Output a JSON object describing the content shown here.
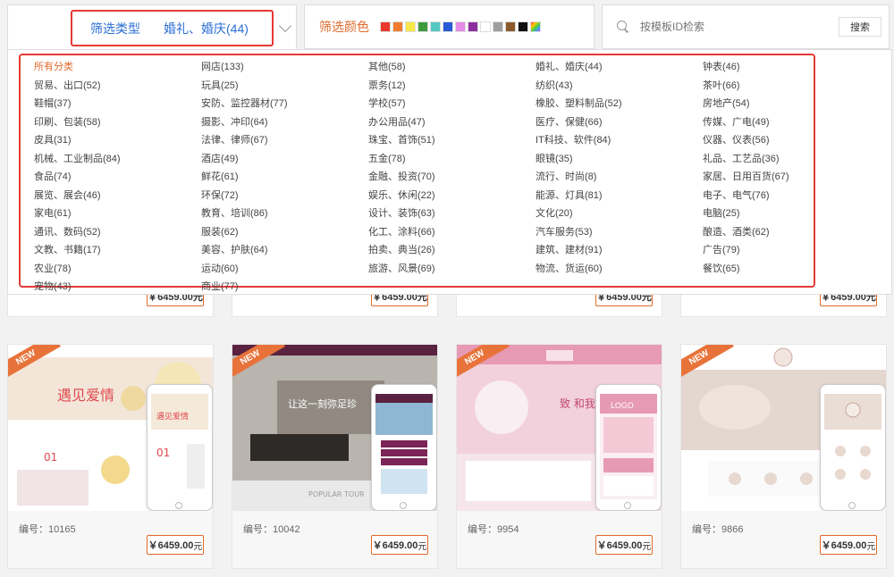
{
  "filters": {
    "type_label": "筛选类型",
    "type_value": "婚礼、婚庆(44)",
    "color_label": "筛选颜色",
    "colors": [
      "#e8392c",
      "#ef7b2f",
      "#f6e84a",
      "#3d9a3d",
      "#55c7c3",
      "#2a5bd7",
      "#e58be6",
      "#8e2fa0",
      "#ffffff",
      "#9e9e9e",
      "#8b5a2b",
      "#111111"
    ],
    "search_placeholder": "按模板ID检索",
    "search_button": "搜索"
  },
  "categories": [
    "所有分类",
    "网店(133)",
    "其他(58)",
    "婚礼、婚庆(44)",
    "钟表(46)",
    "贸易、出口(52)",
    "玩具(25)",
    "票务(12)",
    "纺织(43)",
    "茶叶(66)",
    "鞋帽(37)",
    "安防、监控器材(77)",
    "学校(57)",
    "橡胶、塑料制品(52)",
    "房地产(54)",
    "印刷、包装(58)",
    "摄影、冲印(64)",
    "办公用品(47)",
    "医疗、保健(66)",
    "传媒、广电(49)",
    "皮具(31)",
    "法律、律师(67)",
    "珠宝、首饰(51)",
    "IT科技、软件(84)",
    "仪器、仪表(56)",
    "机械、工业制品(84)",
    "酒店(49)",
    "五金(78)",
    "眼镜(35)",
    "礼品、工艺品(36)",
    "食品(74)",
    "鲜花(61)",
    "金融、投资(70)",
    "流行、时尚(8)",
    "家居、日用百货(67)",
    "展览、展会(46)",
    "环保(72)",
    "娱乐、休闲(22)",
    "能源、灯具(81)",
    "电子、电气(76)",
    "家电(61)",
    "教育、培训(86)",
    "设计、装饰(63)",
    "文化(20)",
    "电脑(25)",
    "通讯、数码(52)",
    "服装(62)",
    "化工、涂料(66)",
    "汽车服务(53)",
    "酿造、酒类(62)",
    "文教、书籍(17)",
    "美容、护肤(64)",
    "拍卖、典当(26)",
    "建筑、建材(91)",
    "广告(79)",
    "农业(78)",
    "运动(60)",
    "旅游、风景(69)",
    "物流、货运(60)",
    "餐饮(65)",
    "宠物(43)",
    "商业(77)"
  ],
  "top_row_price": "￥6459.00元",
  "templates": [
    {
      "badge": "NEW",
      "code": "编号：10165",
      "price_num": "￥6459.00",
      "price_unit": "元"
    },
    {
      "badge": "NEW",
      "code": "编号：10042",
      "price_num": "￥6459.00",
      "price_unit": "元"
    },
    {
      "badge": "NEW",
      "code": "编号：9954",
      "price_num": "￥6459.00",
      "price_unit": "元"
    },
    {
      "badge": "NEW",
      "code": "编号：9866",
      "price_num": "￥6459.00",
      "price_unit": "元"
    }
  ]
}
